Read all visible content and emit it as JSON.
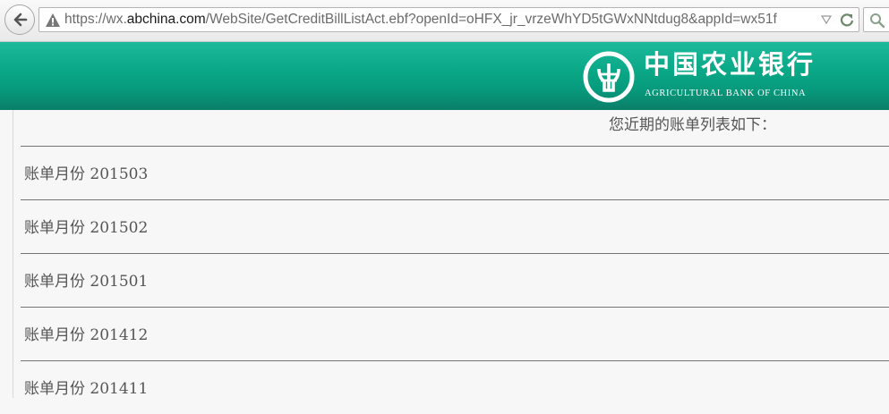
{
  "browser": {
    "url_prefix": "https://wx.",
    "url_host": "abchina.com",
    "url_path": "/WebSite/GetCreditBillListAct.ebf?openId=oHFX_jr_vrzeWhYD5tGWxNNtdug8&appId=wx51f",
    "icons": [
      "back-arrow-icon",
      "warning-icon",
      "dropdown-arrow-icon",
      "reload-icon",
      "search-icon"
    ]
  },
  "bank": {
    "name_cn": "中国农业银行",
    "name_en": "AGRICULTURAL BANK OF CHINA",
    "brand_color": "#079a7c"
  },
  "bills": {
    "heading": "您近期的账单列表如下：",
    "items": [
      {
        "label": "账单月份 201503"
      },
      {
        "label": "账单月份 201502"
      },
      {
        "label": "账单月份 201501"
      },
      {
        "label": "账单月份 201412"
      },
      {
        "label": "账单月份 201411"
      }
    ]
  }
}
